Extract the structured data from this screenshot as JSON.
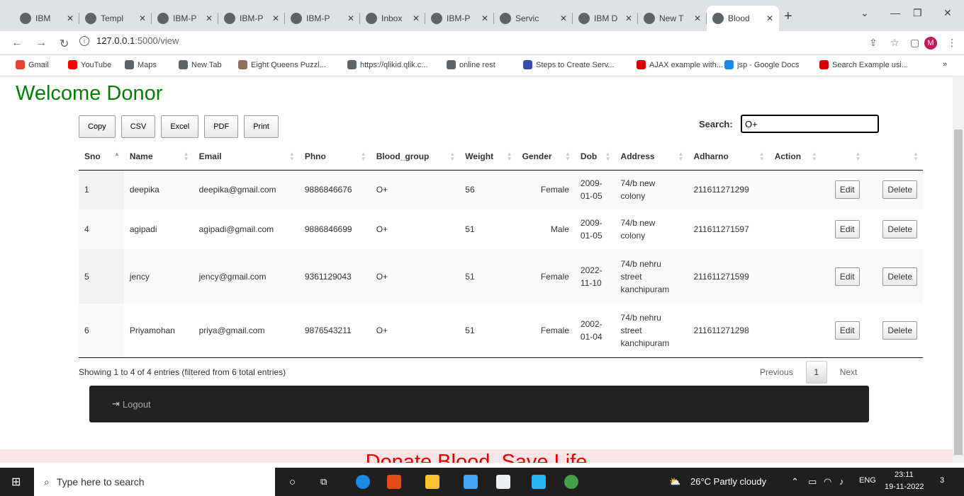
{
  "browser": {
    "tabs": [
      {
        "label": "IBM",
        "icon": "globe-icon"
      },
      {
        "label": "Templ",
        "icon": "drive-icon"
      },
      {
        "label": "IBM-P",
        "icon": "github-icon"
      },
      {
        "label": "IBM-P",
        "icon": "github-icon"
      },
      {
        "label": "IBM-P",
        "icon": "github-icon"
      },
      {
        "label": "Inbox",
        "icon": "gmail-icon"
      },
      {
        "label": "IBM-P",
        "icon": "github-icon"
      },
      {
        "label": "Servic",
        "icon": "cloud-icon"
      },
      {
        "label": "IBM D",
        "icon": "ibm-icon"
      },
      {
        "label": "New T",
        "icon": "globe-icon"
      },
      {
        "label": "Blood",
        "icon": "globe-icon"
      }
    ],
    "url_host": "127.0.0.1",
    "url_path": ":5000/view",
    "avatar_letter": "M",
    "bookmarks": [
      "Gmail",
      "YouTube",
      "Maps",
      "New Tab",
      "Eight Queens Puzzl...",
      "https://qlikid.qlik.c...",
      "online rest",
      "Steps to Create Serv...",
      "AJAX example with...",
      "jsp - Google Docs",
      "Search Example usi..."
    ],
    "bookmarks_more": "»"
  },
  "page": {
    "heading": "Welcome Donor",
    "export_buttons": [
      "Copy",
      "CSV",
      "Excel",
      "PDF",
      "Print"
    ],
    "search_label": "Search:",
    "search_value": "O+",
    "columns": [
      "Sno",
      "Name",
      "Email",
      "Phno",
      "Blood_group",
      "Weight",
      "Gender",
      "Dob",
      "Address",
      "Adharno",
      "Action",
      "",
      ""
    ],
    "rows": [
      {
        "sno": "1",
        "name": "deepika",
        "email": "deepika@gmail.com",
        "phno": "9886846676",
        "blood": "O+",
        "weight": "56",
        "gender": "Female",
        "dob1": "2009-",
        "dob2": "01-05",
        "addr": [
          "74/b new",
          "colony"
        ],
        "adhar": "211611271299"
      },
      {
        "sno": "4",
        "name": "agipadi",
        "email": "agipadi@gmail.com",
        "phno": "9886846699",
        "blood": "O+",
        "weight": "51",
        "gender": "Male",
        "dob1": "2009-",
        "dob2": "01-05",
        "addr": [
          "74/b new",
          "colony"
        ],
        "adhar": "211611271597"
      },
      {
        "sno": "5",
        "name": "jency",
        "email": "jency@gmail.com",
        "phno": "9361129043",
        "blood": "O+",
        "weight": "51",
        "gender": "Female",
        "dob1": "2022-",
        "dob2": "11-10",
        "addr": [
          "74/b nehru",
          "street",
          "kanchipuram"
        ],
        "adhar": "211611271599"
      },
      {
        "sno": "6",
        "name": "Priyamohan",
        "email": "priya@gmail.com",
        "phno": "9876543211",
        "blood": "O+",
        "weight": "51",
        "gender": "Female",
        "dob1": "2002-",
        "dob2": "01-04",
        "addr": [
          "74/b nehru",
          "street",
          "kanchipuram"
        ],
        "adhar": "211611271298"
      }
    ],
    "edit_label": "Edit",
    "delete_label": "Delete",
    "info": "Showing 1 to 4 of 4 entries (filtered from 6 total entries)",
    "pager": {
      "previous": "Previous",
      "current": "1",
      "next": "Next"
    },
    "logout_label": "Logout",
    "banner": "Donate Blood, Save Life"
  },
  "taskbar": {
    "search_placeholder": "Type here to search",
    "weather": "26°C  Partly cloudy",
    "lang": "ENG",
    "time": "23:11",
    "date": "19-11-2022",
    "notif_count": "3"
  }
}
